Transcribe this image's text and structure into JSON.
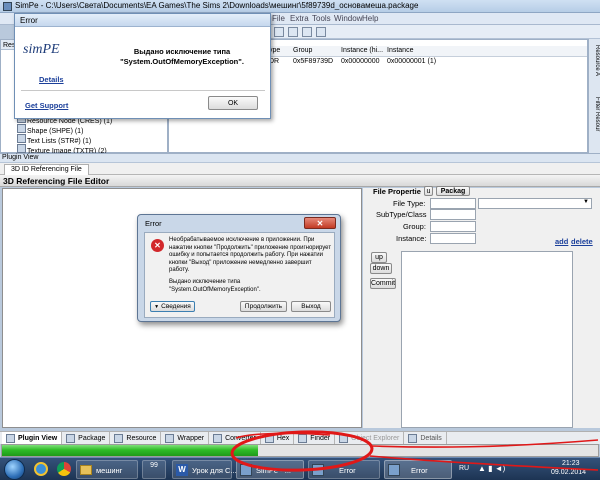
{
  "app": {
    "title": "SimPe - C:\\Users\\Света\\Documents\\EA Games\\The Sims 2\\Downloads\\мешинг\\5f89739d_основамеша.package"
  },
  "menu": [
    "File",
    "Extra",
    "Tools",
    "Window",
    "Help"
  ],
  "resource_panel": {
    "title": "Reso"
  },
  "table": {
    "headers": [
      "ype",
      "Group",
      "Instance (hi...",
      "Instance"
    ],
    "row": [
      "DR",
      "0x5F89739D",
      "0x00000000",
      "0x00000001 (1)"
    ]
  },
  "tree": [
    "Resource Node (CRES) (1)",
    "Shape (SHPE) (1)",
    "Text Lists (STR#) (1)",
    "Texture Image (TXTR) (2)"
  ],
  "side_tabs": [
    "Resource A",
    "Filter Resour"
  ],
  "plugin_view": {
    "title": "Plugin View",
    "tab": "3D ID Referencing File",
    "editor_title": "3D Referencing File Editor"
  },
  "file_props": {
    "title": "File Propertie",
    "mini_tab": "u",
    "package_tab": "Packag",
    "labels": [
      "File Type:",
      "SubType/Class",
      "Group:",
      "Instance:"
    ],
    "add": "add",
    "delete": "delete",
    "up": "up",
    "down": "down",
    "commit": "Commit"
  },
  "simpe_error": {
    "title": "Error",
    "logo": "simPE",
    "message": "Выдано исключение типа \"System.OutOfMemoryException\".",
    "details": "Details",
    "support": "Get Support",
    "ok": "OK"
  },
  "win_error": {
    "title": "Error",
    "message": "Необрабатываемое исключение в приложении. При нажатии кнопки \"Продолжить\" приложение проигнорирует ошибку и попытается продолжить работу. При нажатии кнопки \"Выход\" приложение немедленно завершит работу.",
    "detail": "Выдано исключение типа \"System.OutOfMemoryException\".",
    "details_btn": "Сведения",
    "continue_btn": "Продолжить",
    "exit_btn": "Выход"
  },
  "bottom_tabs": [
    "Plugin View",
    "Package",
    "Resource",
    "Wrapper",
    "Converter",
    "Hex",
    "Finder",
    "Object Explorer",
    "Details"
  ],
  "progress": {
    "value": 0.43,
    "color": "#2ebc27"
  },
  "taskbar": {
    "items": [
      "мешинг",
      "99",
      "Урок для С...",
      "SimPe - ...",
      "Error",
      "Error"
    ],
    "lang": "RU",
    "time": "21:23",
    "date": "09.02.2014"
  },
  "colors": {
    "annotation_red": "#e01818"
  }
}
